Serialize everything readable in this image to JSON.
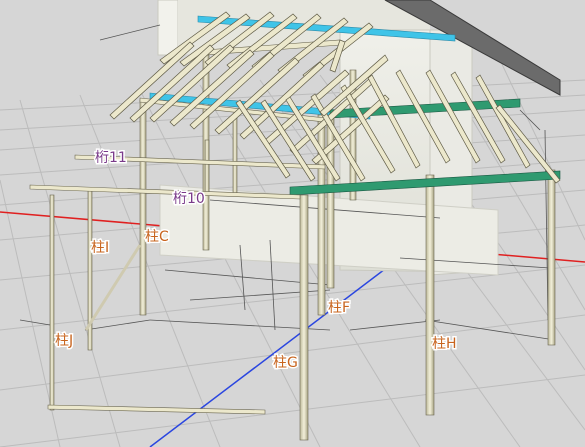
{
  "scene": {
    "background": "#d6d6d6",
    "grid_color": "#b9b9b9",
    "axis_x_color": "#e02020",
    "axis_y_color": "#2040e0",
    "post_color": "#e8e4c4",
    "post_edge": "#5a5a4a",
    "rafter_color": "#ece8cc",
    "blue_beam": "#3ec3e6",
    "green_beam": "#2f9a70",
    "wall_color": "#e9e9e2",
    "roof_color": "#6d6d6d"
  },
  "labels": {
    "keta11": "桁11",
    "keta10": "桁10",
    "hashiraI": "柱I",
    "hashiraC": "柱C",
    "hashiraJ": "柱J",
    "hashiraF": "柱F",
    "hashiraG": "柱G",
    "hashiraH": "柱H"
  }
}
